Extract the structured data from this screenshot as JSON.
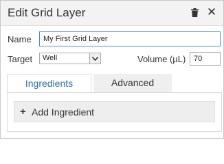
{
  "header": {
    "title": "Edit Grid Layer",
    "close_glyph": "✕"
  },
  "form": {
    "name_label": "Name",
    "name_value": "My First Grid Layer",
    "target_label": "Target",
    "target_selected": "Well",
    "volume_label": "Volume (µL)",
    "volume_value": "70"
  },
  "tabs": [
    {
      "label": "Ingredients",
      "active": true
    },
    {
      "label": "Advanced",
      "active": false
    }
  ],
  "ingredients": {
    "add_icon": "+",
    "add_label": "Add Ingredient"
  },
  "icons": {
    "delete": "trash-icon",
    "close": "close-icon",
    "dropdown": "chevron-down-icon",
    "add": "plus-icon"
  },
  "colors": {
    "header_bg": "#f3f3f3",
    "active_tab_text": "#2b6cb0",
    "input_focus_border": "#4a90c0",
    "inactive_tab_bg": "#efefef"
  }
}
